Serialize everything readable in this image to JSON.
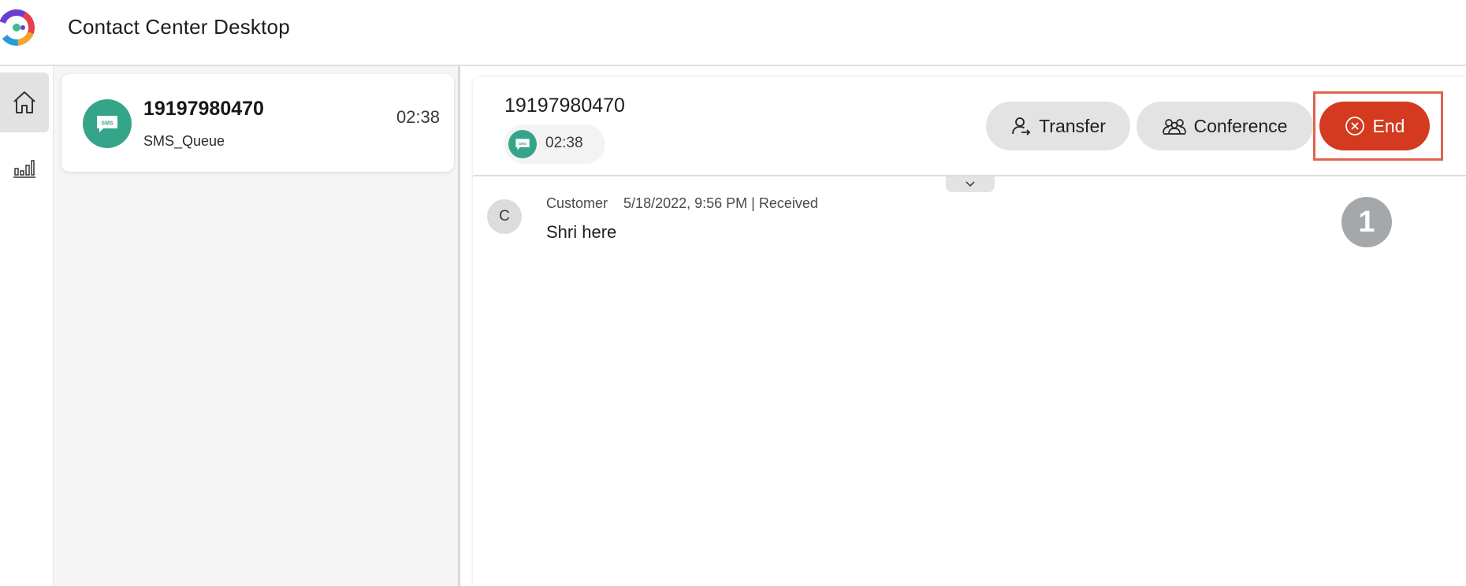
{
  "app": {
    "title": "Contact Center Desktop"
  },
  "nav": {
    "items": [
      {
        "name": "home",
        "icon": "home-icon",
        "active": true
      },
      {
        "name": "statistics",
        "icon": "bar-chart-icon",
        "active": false
      }
    ]
  },
  "tasks": [
    {
      "number": "19197980470",
      "queue": "SMS_Queue",
      "time": "02:38",
      "icon": "sms-icon"
    }
  ],
  "interaction": {
    "number": "19197980470",
    "timer": "02:38",
    "buttons": {
      "transfer": "Transfer",
      "conference": "Conference",
      "end": "End"
    }
  },
  "messages": [
    {
      "avatar_letter": "C",
      "sender": "Customer",
      "timestamp": "5/18/2022, 9:56 PM",
      "status": "Received",
      "text": "Shri here"
    }
  ],
  "unread_badge": "1",
  "colors": {
    "sms_green": "#35a589",
    "end_red": "#d33a1f",
    "highlight": "#e0634f"
  }
}
